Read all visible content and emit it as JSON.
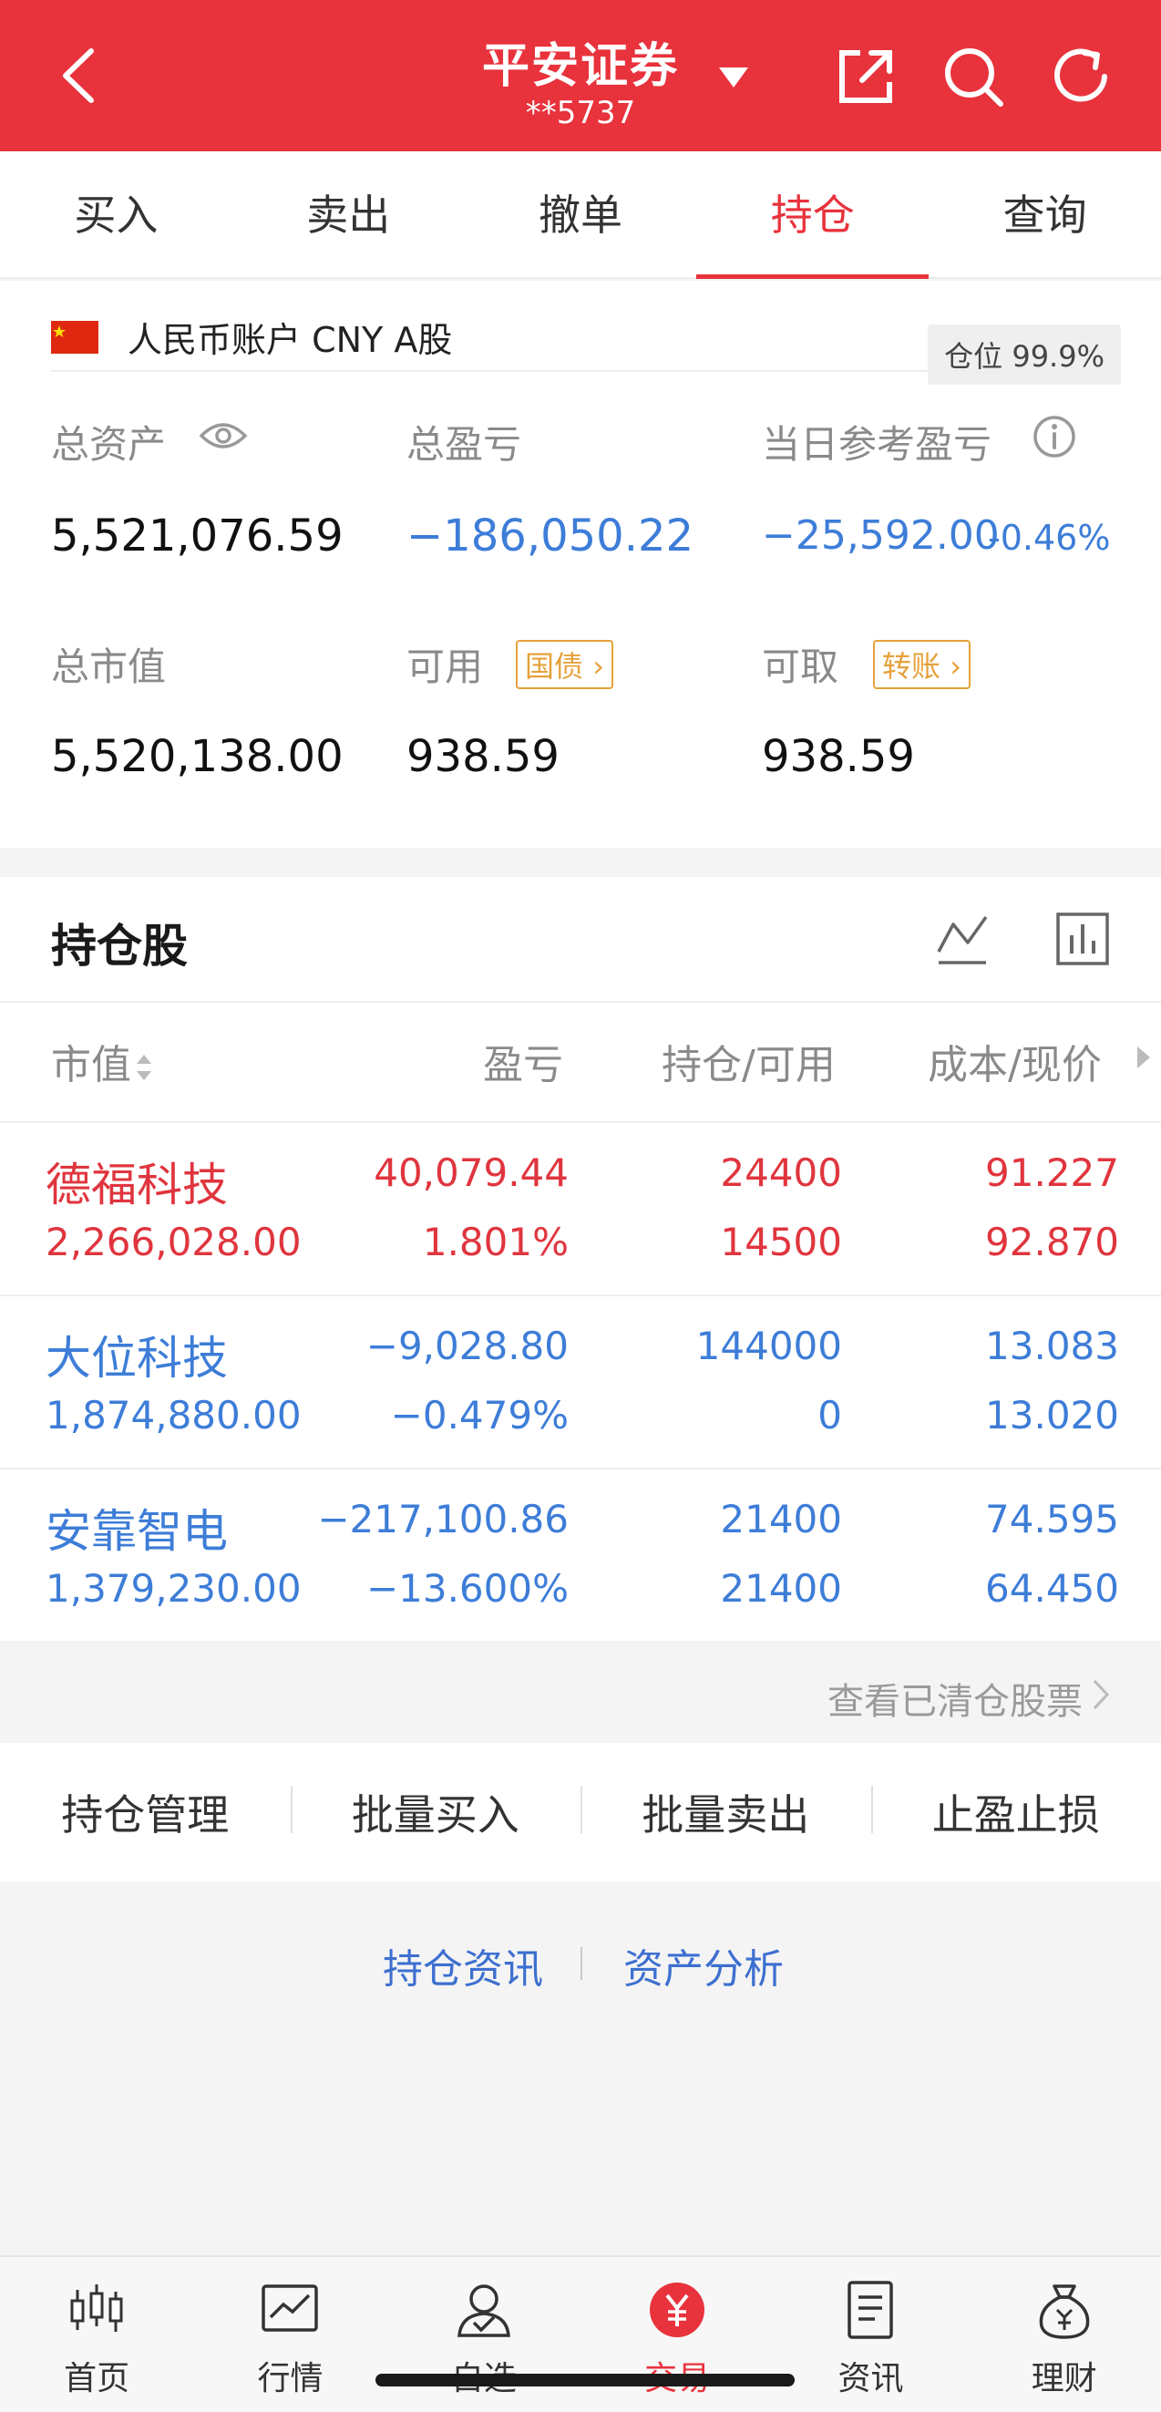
{
  "header": {
    "title": "平安证券",
    "account_masked": "**5737"
  },
  "tabs": [
    {
      "label": "买入",
      "active": false
    },
    {
      "label": "卖出",
      "active": false
    },
    {
      "label": "撤单",
      "active": false
    },
    {
      "label": "持仓",
      "active": true
    },
    {
      "label": "查询",
      "active": false
    }
  ],
  "account": {
    "label": "人民币账户 CNY A股",
    "position_ratio": "仓位 99.9%"
  },
  "summary": {
    "total_assets_label": "总资产",
    "total_assets": "5,521,076.59",
    "total_pnl_label": "总盈亏",
    "total_pnl": "−186,050.22",
    "daily_pnl_label": "当日参考盈亏",
    "daily_pnl": "−25,592.00",
    "daily_pnl_pct": "-0.46%",
    "market_value_label": "总市值",
    "market_value": "5,520,138.00",
    "available_label": "可用",
    "available_tag": "国债",
    "available": "938.59",
    "withdrawable_label": "可取",
    "withdrawable_tag": "转账",
    "withdrawable": "938.59"
  },
  "holdings": {
    "title": "持仓股",
    "columns": [
      "市值",
      "盈亏",
      "持仓/可用",
      "成本/现价"
    ],
    "rows": [
      {
        "name": "德福科技",
        "market_value": "2,266,028.00",
        "pnl": "40,079.44",
        "pnl_pct": "1.801%",
        "position": "24400",
        "available": "14500",
        "cost": "91.227",
        "price": "92.870",
        "color": "red"
      },
      {
        "name": "大位科技",
        "market_value": "1,874,880.00",
        "pnl": "−9,028.80",
        "pnl_pct": "−0.479%",
        "position": "144000",
        "available": "0",
        "cost": "13.083",
        "price": "13.020",
        "color": "blue"
      },
      {
        "name": "安靠智电",
        "market_value": "1,379,230.00",
        "pnl": "−217,100.86",
        "pnl_pct": "−13.600%",
        "position": "21400",
        "available": "21400",
        "cost": "74.595",
        "price": "64.450",
        "color": "blue"
      }
    ],
    "view_cleared": "查看已清仓股票"
  },
  "actions": [
    "持仓管理",
    "批量买入",
    "批量卖出",
    "止盈止损"
  ],
  "links": {
    "left": "持仓资讯",
    "right": "资产分析"
  },
  "bottom_nav": [
    {
      "label": "首页",
      "icon": "candlestick-icon",
      "active": false
    },
    {
      "label": "行情",
      "icon": "chart-icon",
      "active": false
    },
    {
      "label": "自选",
      "icon": "user-icon",
      "active": false
    },
    {
      "label": "交易",
      "icon": "yuan-icon",
      "active": true
    },
    {
      "label": "资讯",
      "icon": "document-icon",
      "active": false
    },
    {
      "label": "理财",
      "icon": "money-bag-icon",
      "active": false
    }
  ],
  "colors": {
    "accent": "#e8323c",
    "up": "#e0353e",
    "down": "#3d7dd8",
    "tag": "#e6a13a"
  }
}
